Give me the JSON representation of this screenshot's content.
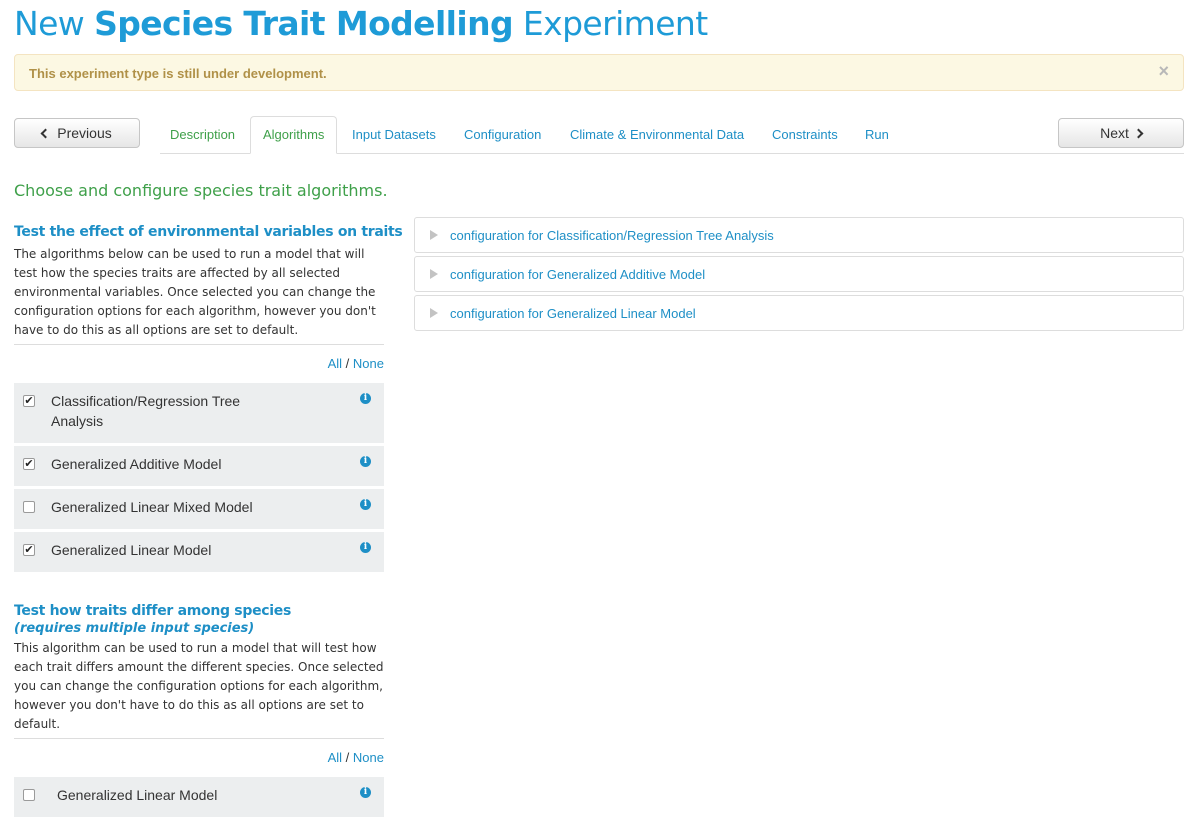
{
  "title": {
    "prefix": "New",
    "strong": "Species Trait Modelling",
    "suffix": "Experiment"
  },
  "alert": {
    "text": "This experiment type is still under development.",
    "close": "×"
  },
  "nav": {
    "previous": "Previous",
    "next": "Next"
  },
  "tabs": [
    {
      "label": "Description",
      "state": "completed"
    },
    {
      "label": "Algorithms",
      "state": "active"
    },
    {
      "label": "Input Datasets",
      "state": "normal"
    },
    {
      "label": "Configuration",
      "state": "normal"
    },
    {
      "label": "Climate & Environmental Data",
      "state": "normal"
    },
    {
      "label": "Constraints",
      "state": "normal"
    },
    {
      "label": "Run",
      "state": "normal"
    }
  ],
  "intro": "Choose and configure species trait algorithms.",
  "section1": {
    "title": "Test the effect of environmental variables on traits",
    "description": "The algorithms below can be used to run a model that will test how the species traits are affected by all selected environmental variables. Once selected you can change the configuration options for each algorithm, however you don't have to do this as all options are set to default.",
    "all": "All",
    "sep": "/",
    "none": "None",
    "algorithms": [
      {
        "label": "Classification/Regression Tree Analysis",
        "checked": true
      },
      {
        "label": "Generalized Additive Model",
        "checked": true
      },
      {
        "label": "Generalized Linear Mixed Model",
        "checked": false
      },
      {
        "label": "Generalized Linear Model",
        "checked": true
      }
    ]
  },
  "section2": {
    "title": "Test how traits differ among species",
    "subtitle": "(requires multiple input species)",
    "description": "This algorithm can be used to run a model that will test how each trait differs amount the different species. Once selected you can change the configuration options for each algorithm, however you don't have to do this as all options are set to default.",
    "all": "All",
    "sep": "/",
    "none": "None",
    "algorithms": [
      {
        "label": "Generalized Linear Model",
        "checked": false
      }
    ]
  },
  "configs": [
    "configuration for Classification/Regression Tree Analysis",
    "configuration for Generalized Additive Model",
    "configuration for Generalized Linear Model"
  ],
  "icons": {
    "info": "info-icon",
    "check": "✔"
  },
  "colors": {
    "accent": "#1e8fc6",
    "success": "#3fa04a",
    "warning_text": "#b09148",
    "warning_bg": "#fcf8e3"
  }
}
